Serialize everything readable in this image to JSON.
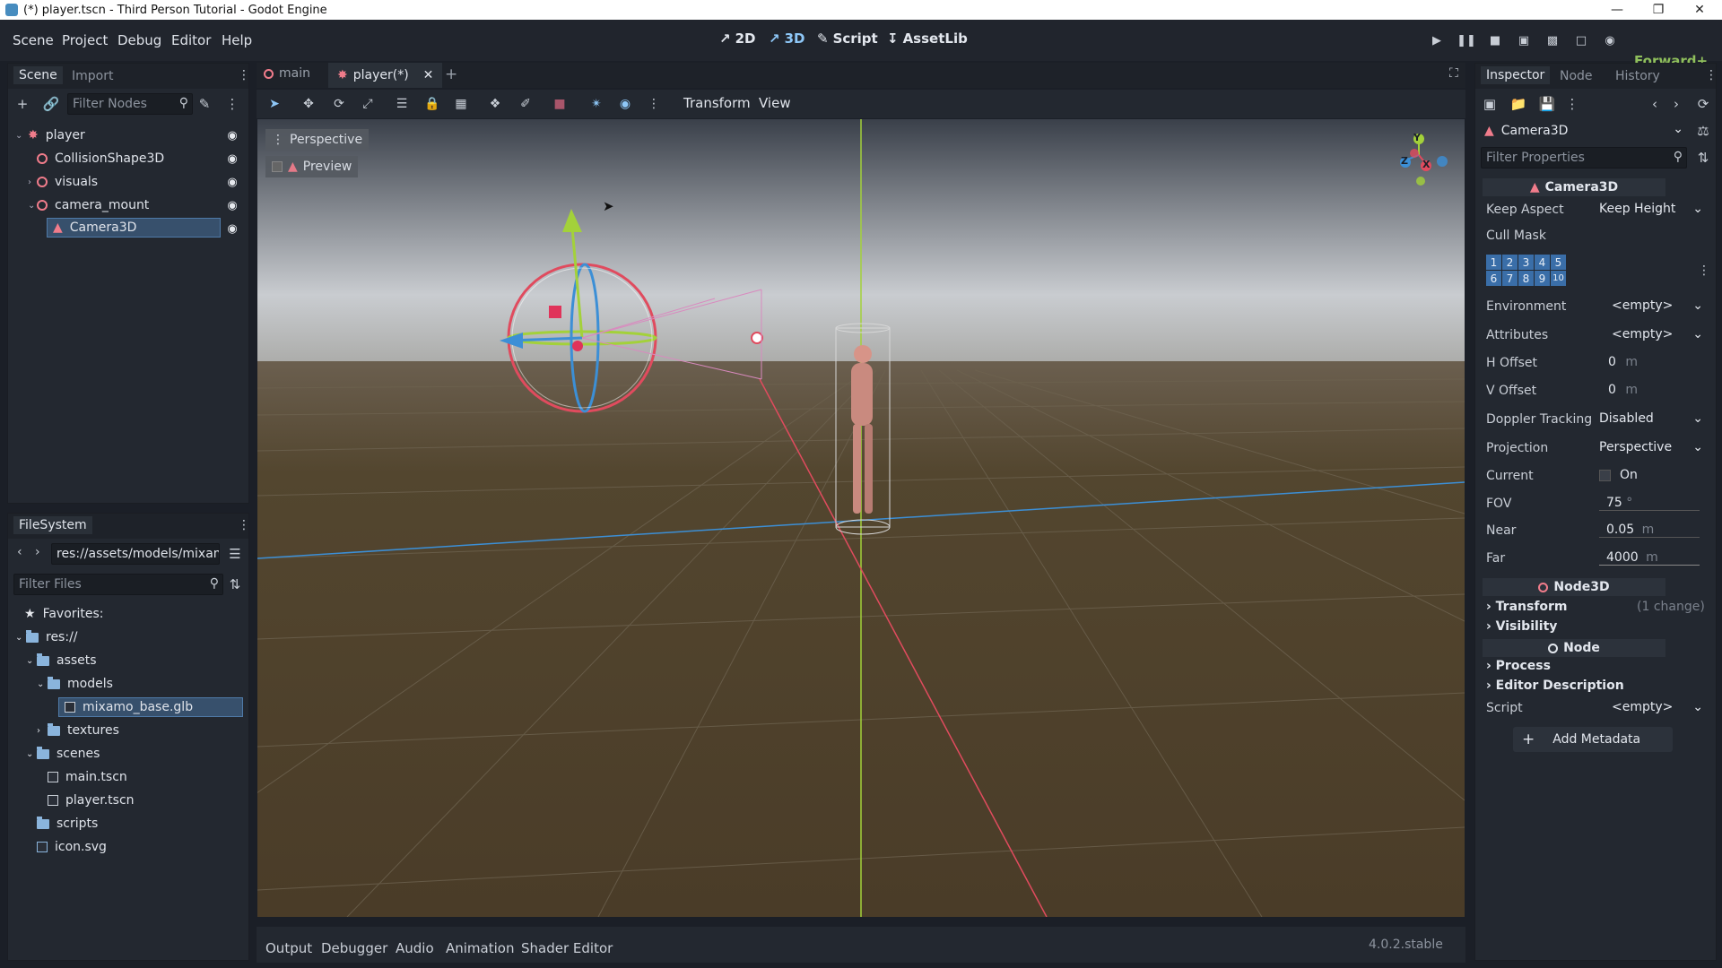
{
  "window": {
    "title": "(*) player.tscn - Third Person Tutorial - Godot Engine"
  },
  "menu": {
    "items": [
      "Scene",
      "Project",
      "Debug",
      "Editor",
      "Help"
    ]
  },
  "main_tabs": {
    "t2d": "2D",
    "t3d": "3D",
    "script": "Script",
    "assetlib": "AssetLib"
  },
  "renderer": "Forward+",
  "scene_dock": {
    "tabs": {
      "scene": "Scene",
      "import": "Import"
    },
    "filter_placeholder": "Filter Nodes",
    "nodes": [
      "player",
      "CollisionShape3D",
      "visuals",
      "camera_mount",
      "Camera3D"
    ]
  },
  "filesystem": {
    "title": "FileSystem",
    "path": "res://assets/models/mixam",
    "filter_placeholder": "Filter Files",
    "items": [
      "Favorites:",
      "res://",
      "assets",
      "models",
      "mixamo_base.glb",
      "textures",
      "scenes",
      "main.tscn",
      "player.tscn",
      "scripts",
      "icon.svg"
    ]
  },
  "scene_tabs": {
    "main": "main",
    "player": "player(*)"
  },
  "viewport_toolbar": {
    "transform": "Transform",
    "view": "View"
  },
  "viewport": {
    "perspective": "Perspective",
    "preview": "Preview"
  },
  "gizmo": {
    "y": "Y",
    "z": "Z",
    "x": "X"
  },
  "inspector": {
    "tabs": {
      "inspector": "Inspector",
      "node": "Node",
      "history": "History"
    },
    "object": "Camera3D",
    "filter_placeholder": "Filter Properties",
    "header_camera": "Camera3D",
    "keep_aspect_label": "Keep Aspect",
    "keep_aspect_value": "Keep Height",
    "cull_mask_label": "Cull Mask",
    "cull_layers": [
      "1",
      "2",
      "3",
      "4",
      "5",
      "6",
      "7",
      "8",
      "9",
      "10"
    ],
    "environment_label": "Environment",
    "environment_value": "<empty>",
    "attributes_label": "Attributes",
    "attributes_value": "<empty>",
    "h_offset_label": "H Offset",
    "h_offset_value": "0",
    "h_offset_unit": "m",
    "v_offset_label": "V Offset",
    "v_offset_value": "0",
    "v_offset_unit": "m",
    "doppler_label": "Doppler Tracking",
    "doppler_value": "Disabled",
    "projection_label": "Projection",
    "projection_value": "Perspective",
    "current_label": "Current",
    "current_value": "On",
    "fov_label": "FOV",
    "fov_value": "75",
    "fov_unit": "°",
    "near_label": "Near",
    "near_value": "0.05",
    "near_unit": "m",
    "far_label": "Far",
    "far_value": "4000",
    "far_unit": "m",
    "header_node3d": "Node3D",
    "transform_label": "Transform",
    "transform_change": "(1 change)",
    "visibility_label": "Visibility",
    "header_node": "Node",
    "process_label": "Process",
    "editor_desc_label": "Editor Description",
    "script_label": "Script",
    "script_value": "<empty>",
    "add_metadata": "Add Metadata"
  },
  "bottom_panel": {
    "tabs": [
      "Output",
      "Debugger",
      "Audio",
      "Animation",
      "Shader Editor"
    ],
    "version": "4.0.2.stable"
  }
}
